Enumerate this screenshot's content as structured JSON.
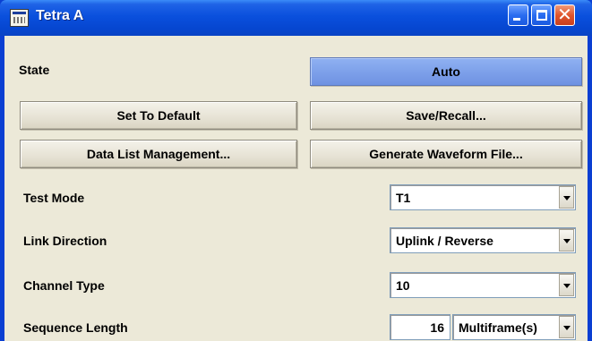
{
  "window": {
    "title": "Tetra A"
  },
  "title_buttons": {
    "minimize_icon": "minimize-icon",
    "maximize_icon": "maximize-icon",
    "close_icon": "close-icon"
  },
  "state": {
    "label": "State",
    "value": "Auto"
  },
  "buttons": {
    "set_to_default": "Set To Default",
    "save_recall": "Save/Recall...",
    "data_list_management": "Data List Management...",
    "generate_waveform_file": "Generate Waveform File..."
  },
  "fields": {
    "test_mode": {
      "label": "Test Mode",
      "value": "T1"
    },
    "link_direction": {
      "label": "Link Direction",
      "value": "Uplink / Reverse"
    },
    "channel_type": {
      "label": "Channel Type",
      "value": "10"
    },
    "sequence_length": {
      "label": "Sequence Length",
      "value": "16",
      "unit": "Multiframe(s)"
    }
  },
  "colors": {
    "title_bar": "#0a50dd",
    "active_button": "#7ea1ea",
    "background": "#ece9d8"
  }
}
